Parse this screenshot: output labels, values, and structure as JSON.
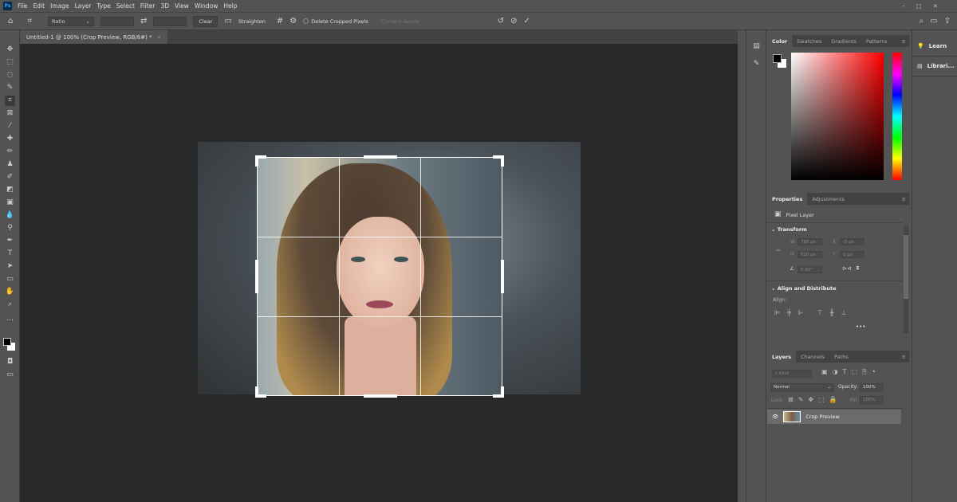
{
  "menu": [
    "File",
    "Edit",
    "Image",
    "Layer",
    "Type",
    "Select",
    "Filter",
    "3D",
    "View",
    "Window",
    "Help"
  ],
  "app_logo": "Ps",
  "options": {
    "ratio": "Ratio",
    "width_value": "",
    "height_value": "",
    "clear": "Clear",
    "straighten": "Straighten",
    "delete_cropped": "Delete Cropped Pixels",
    "content_aware": "Content-Aware"
  },
  "document_tab": {
    "title": "Untitled-1 @ 100% (Crop Preview, RGB/8#) *",
    "close": "×"
  },
  "color_panel": {
    "tabs": [
      "Color",
      "Swatches",
      "Gradients",
      "Patterns"
    ],
    "foreground": "#000000",
    "background": "#ffffff",
    "hue": "#ff0000"
  },
  "learn_panel": {
    "items": [
      "Learn",
      "Librari..."
    ]
  },
  "properties": {
    "tabs": [
      "Properties",
      "Adjustments"
    ],
    "layer_type": "Pixel Layer",
    "transform_title": "Transform",
    "w_label": "W",
    "w": "768 px",
    "x_label": "X",
    "x": "-5 px",
    "h_label": "H",
    "h": "510 px",
    "y_label": "Y",
    "y": "0 px",
    "angle": "0.00°",
    "align_title": "Align and Distribute",
    "align_label": "Align:",
    "more": "•••"
  },
  "layers": {
    "tabs": [
      "Layers",
      "Channels",
      "Paths"
    ],
    "kind_placeholder": "Kind",
    "blend": "Normal",
    "opacity_label": "Opacity:",
    "opacity": "100%",
    "lock_label": "Lock:",
    "fill_label": "Fill:",
    "fill": "100%",
    "items": [
      {
        "name": "Crop Preview",
        "visible": true
      }
    ]
  }
}
